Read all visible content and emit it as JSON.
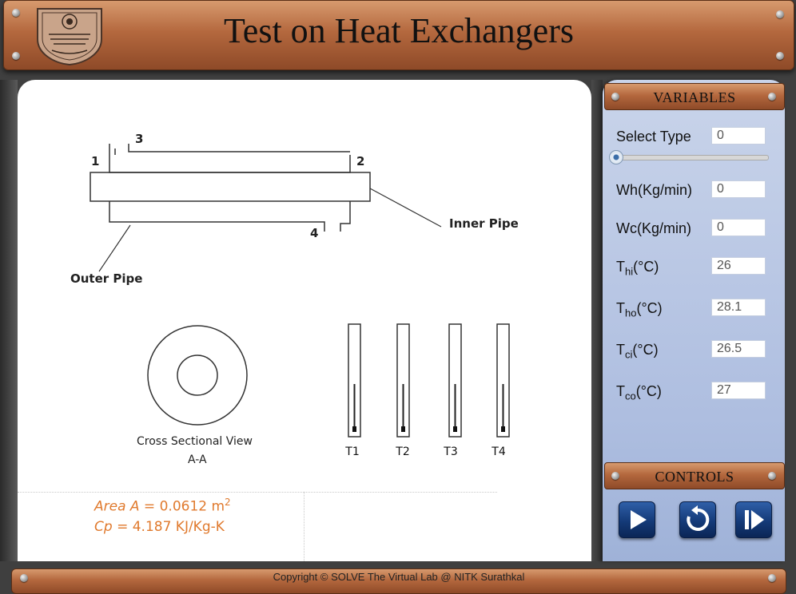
{
  "header": {
    "title": "Test on Heat Exchangers",
    "logo_icon": "nitk-logo-icon"
  },
  "diagram": {
    "port_labels": [
      "1",
      "2",
      "3",
      "4"
    ],
    "inner_pipe_label": "Inner Pipe",
    "outer_pipe_label": "Outer Pipe",
    "cross_section_label_1": "Cross Sectional View",
    "cross_section_label_2": "A-A",
    "thermometers": [
      "T1",
      "T2",
      "T3",
      "T4"
    ]
  },
  "constants": {
    "area_label": "Area A = ",
    "area_value": "0.0612 m",
    "area_sup": "2",
    "cp_label": "Cp = ",
    "cp_value": "4.187 KJ/Kg-K"
  },
  "variables": {
    "heading": "VARIABLES",
    "select_type_label": "Select Type",
    "select_type_value": "0",
    "wh_label": "Wh(Kg/min)",
    "wh_value": "0",
    "wc_label": "Wc(Kg/min)",
    "wc_value": "0",
    "thi_base": "T",
    "thi_sub": "hi",
    "thi_unit": "(°C)",
    "thi_value": "26",
    "tho_base": "T",
    "tho_sub": "ho",
    "tho_unit": "(°C)",
    "tho_value": "28.1",
    "tci_base": "T",
    "tci_sub": "ci",
    "tci_unit": "(°C)",
    "tci_value": "26.5",
    "tco_base": "T",
    "tco_sub": "co",
    "tco_unit": "(°C)",
    "tco_value": "27"
  },
  "controls": {
    "heading": "CONTROLS",
    "play_icon": "play-icon",
    "reset_icon": "reset-icon",
    "step_icon": "step-forward-icon"
  },
  "footer": {
    "copyright": "Copyright © SOLVE The Virtual Lab @ NITK Surathkal"
  }
}
